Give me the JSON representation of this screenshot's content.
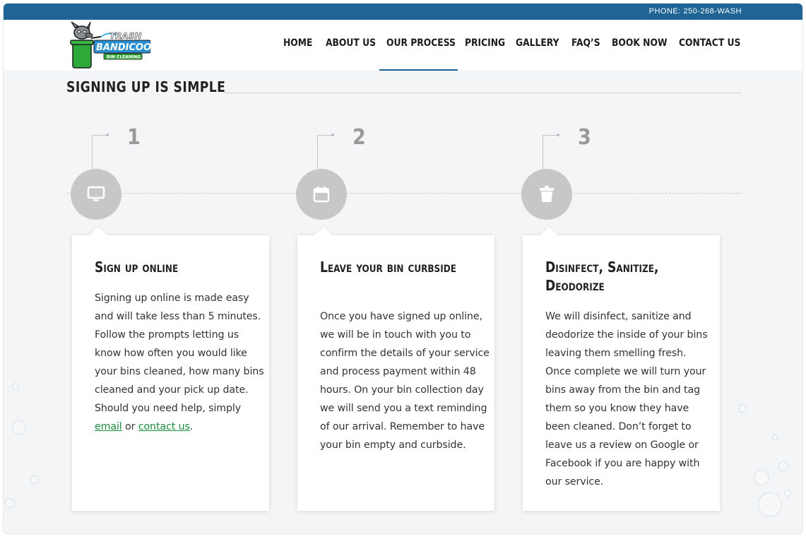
{
  "topbar": {
    "phone": "PHONE: 250-268-WASH"
  },
  "logo": {
    "line1": "TRASH",
    "line2": "BANDICOOT",
    "line3": "BIN CLEANING"
  },
  "nav": {
    "items": [
      {
        "label": "HOME"
      },
      {
        "label": "ABOUT US"
      },
      {
        "label": "OUR PROCESS"
      },
      {
        "label": "PRICING"
      },
      {
        "label": "GALLERY"
      },
      {
        "label": "FAQ’S"
      },
      {
        "label": "BOOK NOW"
      },
      {
        "label": "CONTACT US"
      }
    ],
    "active": "OUR PROCESS"
  },
  "section": {
    "title": "SIGNING UP IS SIMPLE"
  },
  "steps": [
    {
      "number": "1",
      "icon": "monitor-icon",
      "title": "Sign up online",
      "body_before": "Signing up online is made easy and will take less than 5 minutes. Follow the prompts letting us know how often you would like your bins cleaned, how many bins cleaned and your pick up date. Should you need help, simply ",
      "link1": "email",
      "between": " or ",
      "link2": "contact us",
      "after": "."
    },
    {
      "number": "2",
      "icon": "calendar-icon",
      "title": "Leave your bin curbside",
      "body": "Once you have signed up online, we will be in touch with you to confirm the details of your service and process payment within 48 hours. On your bin collection day we will send you a text reminding of our arrival. Remember to have your bin empty and curbside."
    },
    {
      "number": "3",
      "icon": "trash-bin-icon",
      "title": "Disinfect, Sanitize, Deodorize",
      "body": "We will disinfect, sanitize and deodorize the inside of your bins leaving them smelling fresh. Once complete we will turn your bins away from the bin and tag them so you know they have been cleaned. Don’t forget to leave us a review on Google or Facebook if you are happy with our service."
    }
  ],
  "colors": {
    "topbar": "#1e6494",
    "accent_link": "#1a8a3e",
    "circle": "#c6c7c9",
    "background": "#f4f5f6"
  }
}
